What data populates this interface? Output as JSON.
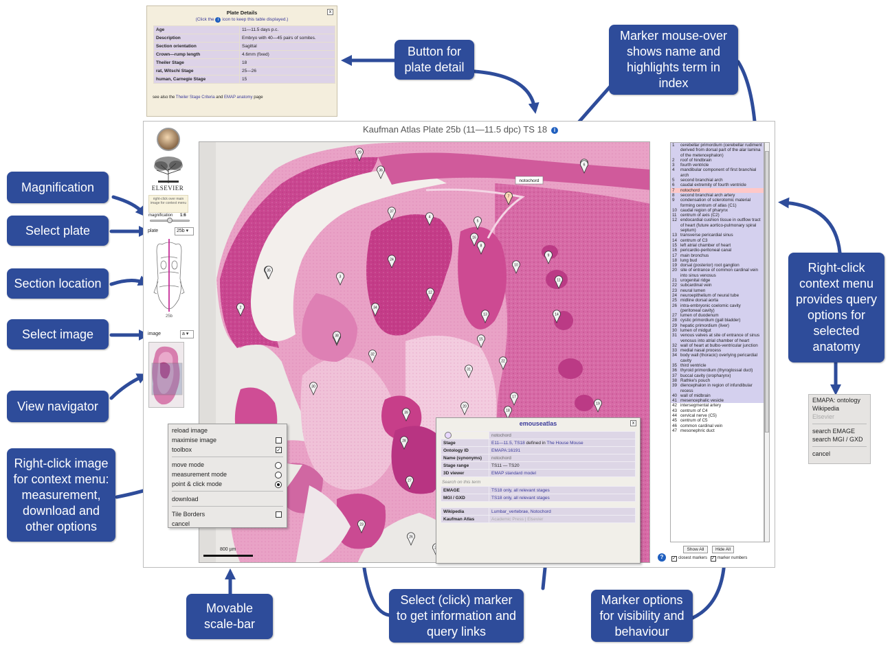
{
  "callouts": {
    "plate_detail": "Button for plate detail",
    "marker_mouseover": "Marker mouse-over shows name and highlights term in index",
    "magnification": "Magnification",
    "select_plate": "Select plate",
    "section_location": "Section location",
    "select_image": "Select image",
    "view_navigator": "View navigator",
    "right_click_image": "Right-click image for context menu: measurement, download and other options",
    "right_click_context": "Right-click context menu provides query options for selected anatomy",
    "scale_bar": "Movable scale-bar",
    "select_marker": "Select (click) marker to get information and query links",
    "marker_options": "Marker options for visibility and behaviour"
  },
  "plate_details": {
    "title": "Plate Details",
    "subtitle_pre": "(Click the",
    "subtitle_post": "icon to keep this table displayed.)",
    "close": "x",
    "rows": [
      {
        "k": "Age",
        "v": "11—11.5 days p.c."
      },
      {
        "k": "Description",
        "v": "Embryo with 40—45 pairs of somites."
      },
      {
        "k": "Section orientation",
        "v": "Sagittal"
      },
      {
        "k": "Crown—rump length",
        "v": "4.6mm (fixed)"
      },
      {
        "k": "Theiler Stage",
        "v": "18"
      },
      {
        "k": "rat, Witschi Stage",
        "v": "25—26"
      },
      {
        "k": "human, Carnegie Stage",
        "v": "15"
      }
    ],
    "footer_pre": "see also the",
    "footer_link1": "Theiler Stage Criteria",
    "footer_mid": "and",
    "footer_link2": "EMAP anatomy",
    "footer_post": "page"
  },
  "viewer": {
    "title": "Kaufman Atlas Plate 25b (11—11.5 dpc) TS 18",
    "info_icon": "i"
  },
  "tools": {
    "publisher": "ELSEVIER",
    "rc_hint": "right-click over main image for context menu",
    "magnification_label": "magnification",
    "magnification_value": "1:6",
    "plate_label": "plate",
    "plate_value": "25b",
    "image_label": "image",
    "image_value": "a",
    "section_caption": "25b"
  },
  "tooltip": "notochord",
  "scale_label": "800 µm",
  "context_menu": {
    "reload": "reload image",
    "maximise": "maximise image",
    "maximise_checked": false,
    "toolbox": "toolbox",
    "toolbox_checked": true,
    "move": "move mode",
    "measure": "measurement mode",
    "point": "point & click mode",
    "selected_mode": "point",
    "download": "download",
    "tile_borders": "Tile Borders",
    "tile_borders_checked": false,
    "cancel": "cancel"
  },
  "emouse": {
    "title": "emouseatlas",
    "close": "x",
    "term": "notochord",
    "stage_k": "Stage",
    "stage_link": "E11—11.5, TS18",
    "stage_mid": "defined in",
    "stage_book": "The House Mouse",
    "ontology_k": "Ontology ID",
    "ontology_v": "EMAPA:16191",
    "name_k": "Name (synonyms)",
    "name_v": "notochord",
    "range_k": "Stage range",
    "range_v": "TS11 — TS20",
    "viewer_k": "3D viewer",
    "viewer_v": "EMAP standard model",
    "search_label": "Search on this term",
    "emage_k": "EMAGE",
    "emage_v": "TS18 only,",
    "emage_v2": "all relevant stages",
    "mgi_k": "MGI / GXD",
    "mgi_v": "TS18 only,",
    "mgi_v2": "all relevant stages",
    "wiki_k": "Wikipedia",
    "wiki_v": "Lumbar_vertebrae, Notochord",
    "kauf_k": "Kaufman Atlas",
    "kauf_v": "Academic Press | Elsevier"
  },
  "term_index": [
    {
      "n": "1",
      "t": "cerebellar primordium (cerebellar rudiment derived from dorsal part of the alar lamina of the metencephalon)"
    },
    {
      "n": "2",
      "t": "roof of hindbrain"
    },
    {
      "n": "3",
      "t": "fourth ventricle"
    },
    {
      "n": "4",
      "t": "mandibular component of first branchial arch"
    },
    {
      "n": "5",
      "t": "second branchial arch"
    },
    {
      "n": "6",
      "t": "caudal extremity of fourth ventricle"
    },
    {
      "n": "7",
      "t": "notochord"
    },
    {
      "n": "8",
      "t": "second branchial arch artery"
    },
    {
      "n": "9",
      "t": "condensation of sclerotomic material forming centrum of atlas (C1)"
    },
    {
      "n": "10",
      "t": "caudal region of pharynx"
    },
    {
      "n": "11",
      "t": "centrum of axis (C2)"
    },
    {
      "n": "12",
      "t": "endocardial cushion tissue in outflow tract of heart (future aortico-pulmonary spiral septum)"
    },
    {
      "n": "13",
      "t": "transverse pericardial sinus"
    },
    {
      "n": "14",
      "t": "centrum of C3"
    },
    {
      "n": "15",
      "t": "left atrial chamber of heart"
    },
    {
      "n": "16",
      "t": "pericardio-peritoneal canal"
    },
    {
      "n": "17",
      "t": "main bronchus"
    },
    {
      "n": "18",
      "t": "lung bud"
    },
    {
      "n": "19",
      "t": "dorsal (posterior) root ganglion"
    },
    {
      "n": "20",
      "t": "site of entrance of common cardinal vein into sinus venosus"
    },
    {
      "n": "21",
      "t": "urogenital ridge"
    },
    {
      "n": "22",
      "t": "subcardinal vein"
    },
    {
      "n": "23",
      "t": "neural lumen"
    },
    {
      "n": "24",
      "t": "neuroepithelium of neural tube"
    },
    {
      "n": "25",
      "t": "midline dorsal aorta"
    },
    {
      "n": "26",
      "t": "intra-embryonic coelomic cavity (peritoneal cavity)"
    },
    {
      "n": "27",
      "t": "lumen of duodenum"
    },
    {
      "n": "28",
      "t": "cystic primordium (gall bladder)"
    },
    {
      "n": "29",
      "t": "hepatic primordium (liver)"
    },
    {
      "n": "30",
      "t": "lumen of midgut"
    },
    {
      "n": "31",
      "t": "venous valves at site of entrance of sinus venosus into atrial chamber of heart"
    },
    {
      "n": "32",
      "t": "wall of heart at bulbo-ventricular junction"
    },
    {
      "n": "33",
      "t": "medial nasal process"
    },
    {
      "n": "34",
      "t": "body wall (thoracic) overlying pericardial cavity"
    },
    {
      "n": "35",
      "t": "third ventricle"
    },
    {
      "n": "36",
      "t": "thyroid primordium (thyroglossal duct)"
    },
    {
      "n": "37",
      "t": "buccal cavity (oropharynx)"
    },
    {
      "n": "38",
      "t": "Rathke's pouch"
    },
    {
      "n": "39",
      "t": "diencephalon in region of infundibular recess"
    },
    {
      "n": "40",
      "t": "wall of midbrain"
    },
    {
      "n": "41",
      "t": "mesencephalic vesicle"
    },
    {
      "n": "42",
      "t": "intersegmental artery"
    },
    {
      "n": "43",
      "t": "centrum of C4"
    },
    {
      "n": "44",
      "t": "cervical nerve (C5)"
    },
    {
      "n": "45",
      "t": "centrum of C5"
    },
    {
      "n": "46",
      "t": "common cardinal vein"
    },
    {
      "n": "47",
      "t": "mesonephric duct"
    }
  ],
  "term_selected": "7",
  "term_highlight_max": 41,
  "index_controls": {
    "show_all": "Show All",
    "hide_all": "Hide All",
    "closest_markers": "closest markers",
    "marker_numbers": "marker numbers",
    "help": "?"
  },
  "query_menu": {
    "emapa": "EMAPA: ontology",
    "wikipedia": "Wikipedia",
    "elsevier": "Elsevier",
    "emage": "search EMAGE",
    "mgi": "search MGI / GXD",
    "cancel": "cancel"
  },
  "markers": [
    "1",
    "2",
    "3",
    "4",
    "5",
    "6",
    "7",
    "8",
    "9",
    "10",
    "11",
    "12",
    "13",
    "14",
    "15",
    "16",
    "17",
    "18",
    "19",
    "20",
    "21",
    "22",
    "23",
    "24",
    "25",
    "26",
    "27",
    "28",
    "29",
    "30",
    "31",
    "32",
    "33",
    "34",
    "35",
    "36",
    "37",
    "38",
    "39"
  ],
  "colors": {
    "callout": "#2e4c9a",
    "tissue_dark": "#c53f8a",
    "tissue_light": "#eea5c8",
    "highlight_term": "#d4d0ee",
    "selected_term": "#ffc8c8",
    "link": "#3a3a9a"
  }
}
